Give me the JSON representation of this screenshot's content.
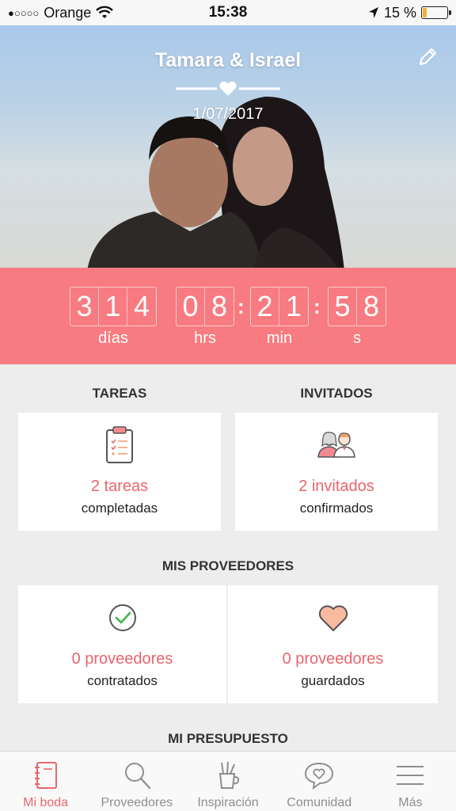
{
  "status_bar": {
    "signal": "●○○○○",
    "carrier": "Orange",
    "time": "15:38",
    "battery_percent": "15 %",
    "battery_level": 0.15,
    "icons": [
      "wifi-icon",
      "location-arrow-icon",
      "battery-icon"
    ]
  },
  "hero": {
    "couple_names": "Tamara & Israel",
    "wedding_date": "1/07/2017",
    "icons": [
      "heart-divider-icon",
      "edit-pencil-icon"
    ]
  },
  "countdown": {
    "days": [
      "3",
      "1",
      "4"
    ],
    "hours": [
      "0",
      "8"
    ],
    "minutes": [
      "2",
      "1"
    ],
    "seconds": [
      "5",
      "8"
    ],
    "labels": {
      "days": "días",
      "hours": "hrs",
      "minutes": "min",
      "seconds": "s"
    }
  },
  "sections": {
    "tasks": {
      "header": "TAREAS",
      "count": "2 tareas",
      "subtitle": "completadas",
      "icon": "clipboard-checklist-icon"
    },
    "guests": {
      "header": "INVITADOS",
      "count": "2 invitados",
      "subtitle": "confirmados",
      "icon": "guests-couple-icon"
    },
    "vendors": {
      "header": "MIS PROVEEDORES",
      "hired": {
        "count": "0 proveedores",
        "subtitle": "contratados",
        "icon": "checkmark-circle-icon"
      },
      "saved": {
        "count": "0 proveedores",
        "subtitle": "guardados",
        "icon": "heart-icon"
      }
    },
    "budget": {
      "header": "MI PRESUPUESTO"
    }
  },
  "tab_bar": {
    "items": [
      {
        "label": "Mi boda",
        "icon": "notebook-icon",
        "active": true
      },
      {
        "label": "Proveedores",
        "icon": "search-icon",
        "active": false
      },
      {
        "label": "Inspiración",
        "icon": "pencil-cup-icon",
        "active": false
      },
      {
        "label": "Comunidad",
        "icon": "chat-heart-icon",
        "active": false
      },
      {
        "label": "Más",
        "icon": "menu-icon",
        "active": false
      }
    ]
  },
  "colors": {
    "accent": "#f77b81",
    "accent_text": "#e8666d",
    "background": "#ededed",
    "card": "#ffffff"
  }
}
